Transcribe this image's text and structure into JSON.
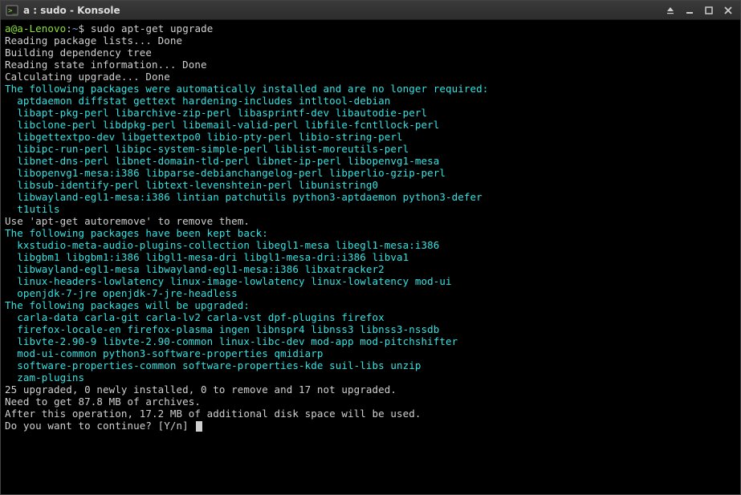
{
  "window": {
    "title": "a : sudo - Konsole"
  },
  "term": {
    "prompt_userhost": "a@a-Lenovo",
    "prompt_sep": ":",
    "prompt_path": "~",
    "prompt_dollar": "$",
    "command": "sudo apt-get upgrade",
    "l1": "Reading package lists... Done",
    "l2": "Building dependency tree",
    "l3": "Reading state information... Done",
    "l4": "Calculating upgrade... Done",
    "auto_header": "The following packages were automatically installed and are no longer required:",
    "auto1": "  aptdaemon diffstat gettext hardening-includes intltool-debian",
    "auto2": "  libapt-pkg-perl libarchive-zip-perl libasprintf-dev libautodie-perl",
    "auto3": "  libclone-perl libdpkg-perl libemail-valid-perl libfile-fcntllock-perl",
    "auto4": "  libgettextpo-dev libgettextpo0 libio-pty-perl libio-string-perl",
    "auto5": "  libipc-run-perl libipc-system-simple-perl liblist-moreutils-perl",
    "auto6": "  libnet-dns-perl libnet-domain-tld-perl libnet-ip-perl libopenvg1-mesa",
    "auto7": "  libopenvg1-mesa:i386 libparse-debianchangelog-perl libperlio-gzip-perl",
    "auto8": "  libsub-identify-perl libtext-levenshtein-perl libunistring0",
    "auto9": "  libwayland-egl1-mesa:i386 lintian patchutils python3-aptdaemon python3-defer",
    "auto10": "  t1utils",
    "auto_hint": "Use 'apt-get autoremove' to remove them.",
    "kept_header": "The following packages have been kept back:",
    "kept1": "  kxstudio-meta-audio-plugins-collection libegl1-mesa libegl1-mesa:i386",
    "kept2": "  libgbm1 libgbm1:i386 libgl1-mesa-dri libgl1-mesa-dri:i386 libva1",
    "kept3": "  libwayland-egl1-mesa libwayland-egl1-mesa:i386 libxatracker2",
    "kept4": "  linux-headers-lowlatency linux-image-lowlatency linux-lowlatency mod-ui",
    "kept5": "  openjdk-7-jre openjdk-7-jre-headless",
    "upg_header": "The following packages will be upgraded:",
    "upg1": "  carla-data carla-git carla-lv2 carla-vst dpf-plugins firefox",
    "upg2": "  firefox-locale-en firefox-plasma ingen libnspr4 libnss3 libnss3-nssdb",
    "upg3": "  libvte-2.90-9 libvte-2.90-common linux-libc-dev mod-app mod-pitchshifter",
    "upg4": "  mod-ui-common python3-software-properties qmidiarp",
    "upg5": "  software-properties-common software-properties-kde suil-libs unzip",
    "upg6": "  zam-plugins",
    "summary1": "25 upgraded, 0 newly installed, 0 to remove and 17 not upgraded.",
    "summary2": "Need to get 87.8 MB of archives.",
    "summary3": "After this operation, 17.2 MB of additional disk space will be used.",
    "continue_q": "Do you want to continue? [Y/n] "
  }
}
